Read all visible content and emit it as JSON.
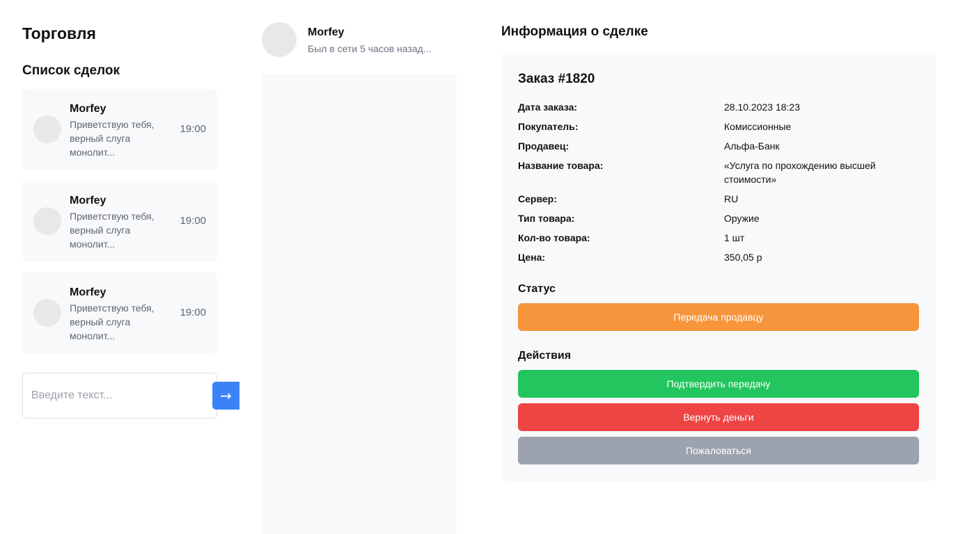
{
  "header": {
    "title": "Торговля"
  },
  "deals": {
    "title": "Список сделок",
    "items": [
      {
        "name": "Morfey",
        "message": "Приветствую тебя, верный слуга монолит...",
        "time": "19:00"
      },
      {
        "name": "Morfey",
        "message": "Приветствую тебя, верный слуга монолит...",
        "time": "19:00"
      },
      {
        "name": "Morfey",
        "message": "Приветствую тебя, верный слуга монолит...",
        "time": "19:00"
      }
    ]
  },
  "composer": {
    "placeholder": "Введите текст...",
    "send_label": "→"
  },
  "chat": {
    "name": "Morfey",
    "status": "Был в сети 5 часов назад..."
  },
  "info": {
    "title": "Информация о сделке",
    "order_title": "Заказ #1820",
    "rows": [
      {
        "label": "Дата заказа:",
        "value": "28.10.2023 18:23"
      },
      {
        "label": "Покупатель:",
        "value": "Комиссионные"
      },
      {
        "label": "Продавец:",
        "value": "Альфа-Банк"
      },
      {
        "label": "Название товара:",
        "value": "«Услуга по прохождению высшей стоимости»"
      },
      {
        "label": "Сервер:",
        "value": "RU"
      },
      {
        "label": "Тип товара:",
        "value": "Оружие"
      },
      {
        "label": "Кол-во товара:",
        "value": "1 шт"
      },
      {
        "label": "Цена:",
        "value": "350,05 р"
      }
    ],
    "status_label": "Статус",
    "status_value": "Передача продавцу",
    "actions_label": "Действия",
    "actions": {
      "confirm": "Подтвердить передачу",
      "refund": "Вернуть деньги",
      "report": "Пожаловаться"
    }
  },
  "colors": {
    "status": "#f7953c",
    "confirm": "#22c55e",
    "refund": "#ef4444",
    "report": "#9ca3af",
    "send": "#3b82f6"
  }
}
